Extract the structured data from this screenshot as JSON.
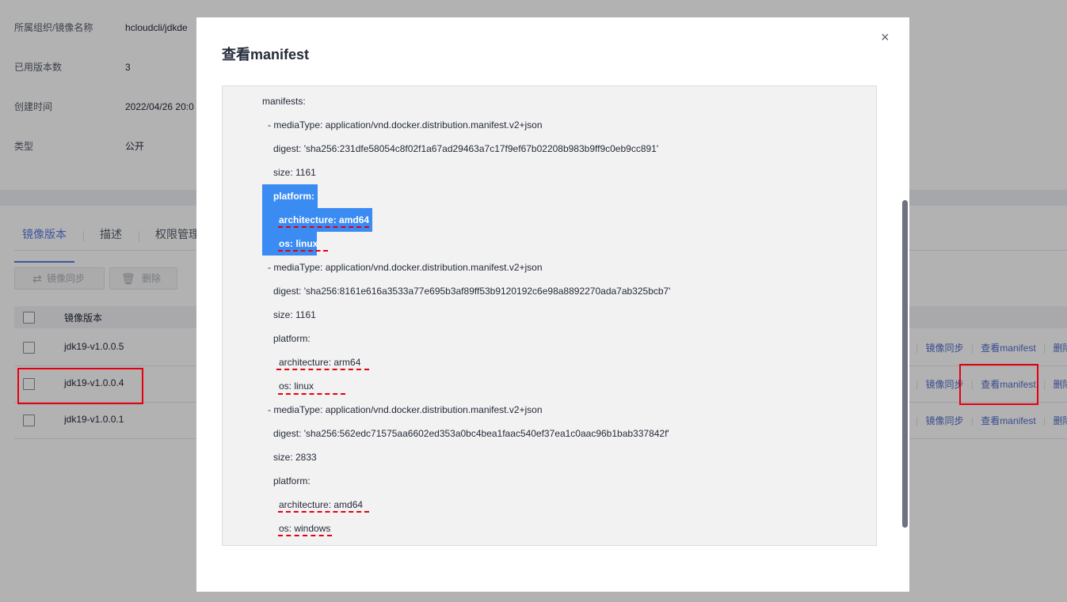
{
  "info": [
    {
      "label": "所属组织/镜像名称",
      "value": "hcloudcli/jdkde"
    },
    {
      "label": "已用版本数",
      "value": "3"
    },
    {
      "label": "创建时间",
      "value": "2022/04/26 20:0"
    },
    {
      "label": "类型",
      "value": "公开"
    }
  ],
  "tabs": [
    {
      "label": "镜像版本",
      "active": true
    },
    {
      "label": "描述",
      "active": false
    },
    {
      "label": "权限管理",
      "active": false
    }
  ],
  "toolbar": {
    "sync_label": "镜像同步",
    "delete_label": "删除",
    "sync_icon": "⇄",
    "delete_icon": "🗑"
  },
  "table": {
    "header_version": "镜像版本",
    "rows": [
      {
        "version": "jdk19-v1.0.0.5",
        "op_sync": "镜像同步",
        "op_manifest": "查看manifest",
        "op_delete": "删除"
      },
      {
        "version": "jdk19-v1.0.0.4",
        "op_sync": "镜像同步",
        "op_manifest": "查看manifest",
        "op_delete": "删除"
      },
      {
        "version": "jdk19-v1.0.0.1",
        "op_sync": "镜像同步",
        "op_manifest": "查看manifest",
        "op_delete": "删除"
      }
    ]
  },
  "modal": {
    "title": "查看manifest",
    "close_icon": "×",
    "manifest_lines": [
      "manifests:",
      "  - mediaType: application/vnd.docker.distribution.manifest.v2+json",
      "    digest: 'sha256:231dfe58054c8f02f1a67ad29463a7c17f9ef67b02208b983b9ff9c0eb9cc891'",
      "    size: 1161",
      "    platform:",
      "      architecture: amd64",
      "      os: linux",
      "  - mediaType: application/vnd.docker.distribution.manifest.v2+json",
      "    digest: 'sha256:8161e616a3533a77e695b3af89ff53b9120192c6e98a8892270ada7ab325bcb7'",
      "    size: 1161",
      "    platform:",
      "      architecture: arm64",
      "      os: linux",
      "  - mediaType: application/vnd.docker.distribution.manifest.v2+json",
      "    digest: 'sha256:562edc71575aa6602ed353a0bc4bea1faac540ef37ea1c0aac96b1bab337842f'",
      "    size: 2833",
      "    platform:",
      "      architecture: amd64",
      "      os: windows"
    ]
  },
  "colors": {
    "accent": "#5e7ce0",
    "link": "#526ecc",
    "highlight": "#3b8cf2",
    "annotation": "#e6000f"
  }
}
